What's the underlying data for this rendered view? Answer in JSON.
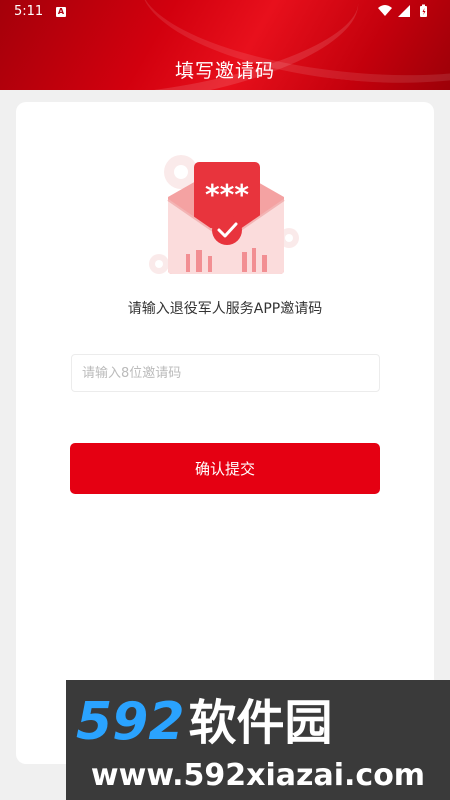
{
  "status_bar": {
    "time": "5:11",
    "notification_badge": "A",
    "icons": [
      "wifi-icon",
      "signal-icon",
      "battery-icon"
    ]
  },
  "header": {
    "title": "填写邀请码"
  },
  "main": {
    "illustration": {
      "masked_code": "***",
      "icons": [
        "envelope-icon",
        "check-badge-icon",
        "gear-icon"
      ]
    },
    "description": "请输入退役军人服务APP邀请码",
    "invite_input": {
      "value": "",
      "placeholder": "请输入8位邀请码"
    },
    "submit_label": "确认提交"
  },
  "watermark": {
    "brand_number": "592",
    "brand_text": "软件园",
    "url": "www.592xiazai.com"
  },
  "colors": {
    "brand_red": "#e50012",
    "header_red": "#c3000c",
    "background": "#f0f0f0",
    "watermark_blue": "#2aa3ff"
  }
}
